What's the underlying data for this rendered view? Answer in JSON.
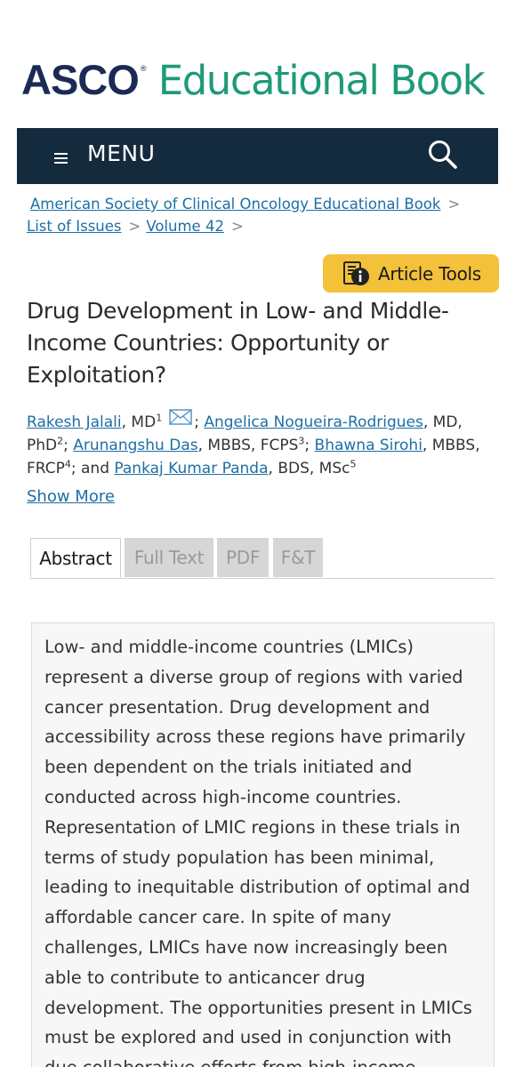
{
  "logo": {
    "brand": "ASCO",
    "registered_mark": "®",
    "product": "Educational Book"
  },
  "nav": {
    "menu_label": "MENU"
  },
  "breadcrumb": {
    "items": [
      "American Society of Clinical Oncology Educational Book",
      "List of Issues",
      "Volume 42"
    ],
    "separator": ">"
  },
  "article_tools": {
    "label": "Article Tools"
  },
  "article": {
    "title": "Drug Development in Low- and Middle-Income Countries: Opportunity or Exploitation?",
    "authors": [
      {
        "name": "Rakesh Jalali",
        "credentials": ", MD",
        "sup": "1"
      },
      {
        "name": "Angelica Nogueira-Rodrigues",
        "credentials": ", MD, PhD",
        "sup": "2"
      },
      {
        "name": "Arunangshu Das",
        "credentials": ", MBBS, FCPS",
        "sup": "3"
      },
      {
        "name": "Bhawna Sirohi",
        "credentials": ", MBBS, FRCP",
        "sup": "4"
      },
      {
        "name": "Pankaj Kumar Panda",
        "credentials": ", BDS, MSc",
        "sup": "5"
      }
    ],
    "separator": "; ",
    "last_connector": "and ",
    "show_more_label": "Show More"
  },
  "tabs": [
    {
      "label": "Abstract",
      "active": true
    },
    {
      "label": "Full Text",
      "active": false
    },
    {
      "label": "PDF",
      "active": false
    },
    {
      "label": "F&T",
      "active": false
    }
  ],
  "abstract": {
    "text": "Low- and middle-income countries (LMICs) represent a diverse group of regions with varied cancer presentation. Drug development and accessibility across these regions have primarily been dependent on the trials initiated and conducted across high-income countries. Representation of LMIC regions in these trials in terms of study population has been minimal, leading to inequitable distribution of optimal and affordable cancer care. In spite of many challenges, LMICs have now increasingly been able to contribute to anticancer drug development. The opportunities present in LMICs must be explored and used in conjunction with due collaborative efforts from high-income"
  },
  "colors": {
    "brand_navy": "#1b2a55",
    "brand_green": "#1e9a78",
    "nav_bg": "#142a3d",
    "link": "#1d6fa5",
    "tools_bg": "#f3c13a"
  },
  "icons": [
    "hamburger-icon",
    "search-icon",
    "article-info-icon",
    "mail-icon"
  ]
}
